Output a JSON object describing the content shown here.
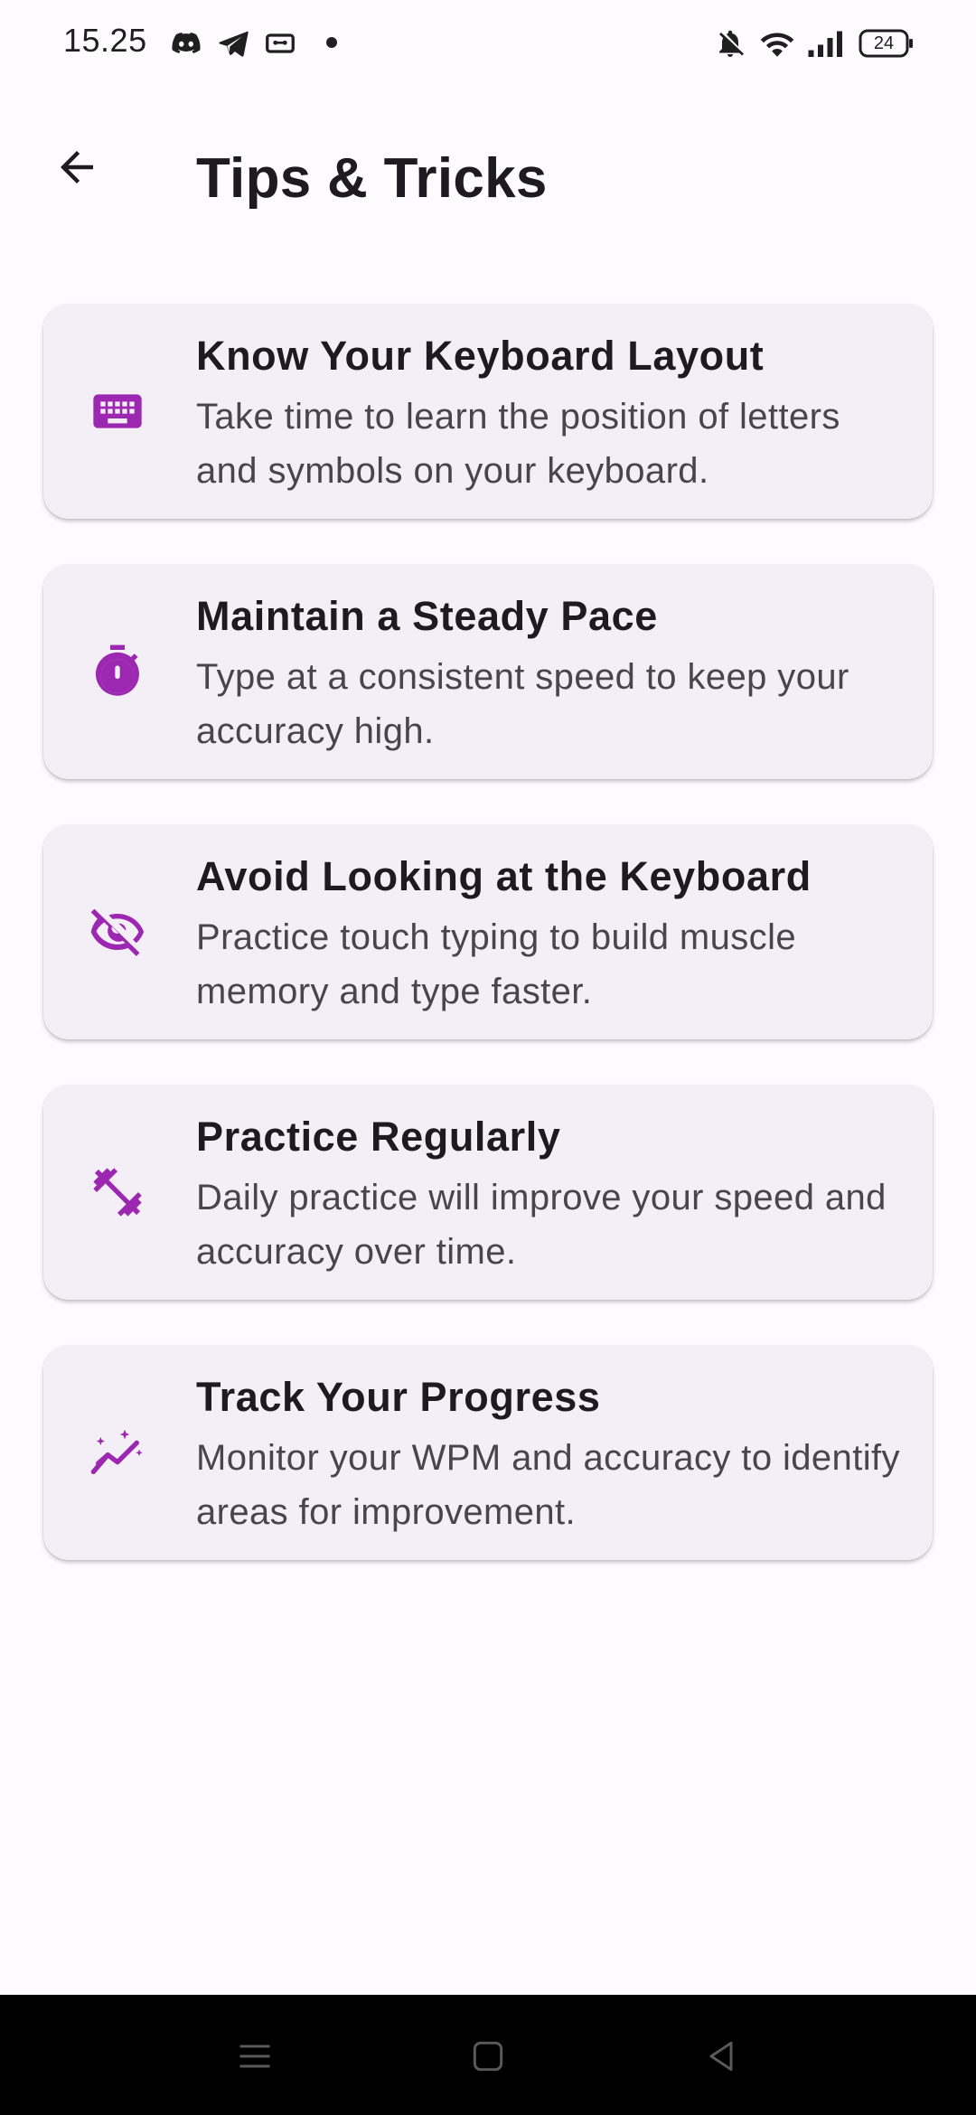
{
  "status_bar": {
    "time": "15.25",
    "battery": "24",
    "icons": [
      "discord-icon",
      "telegram-icon",
      "cassette-icon",
      "dot-icon",
      "bell-off-icon",
      "wifi-icon",
      "signal-icon",
      "battery-icon"
    ]
  },
  "app_bar": {
    "title": "Tips & Tricks",
    "back_icon": "arrow-left-icon"
  },
  "tips": [
    {
      "icon": "keyboard-icon",
      "title": "Know Your Keyboard Layout",
      "description": "Take time to learn the position of letters and symbols on your keyboard."
    },
    {
      "icon": "timer-icon",
      "title": "Maintain a Steady Pace",
      "description": "Type at a consistent speed to keep your accuracy high."
    },
    {
      "icon": "visibility-off-icon",
      "title": "Avoid Looking at the Keyboard",
      "description": "Practice touch typing to build muscle memory and type faster."
    },
    {
      "icon": "fitness-icon",
      "title": "Practice Regularly",
      "description": "Daily practice will improve your speed and accuracy over time."
    },
    {
      "icon": "insights-icon",
      "title": "Track Your Progress",
      "description": "Monitor your WPM and accuracy to identify areas for improvement."
    }
  ],
  "nav_bar": {
    "buttons": [
      "menu-icon",
      "home-icon",
      "back-triangle-icon"
    ]
  },
  "colors": {
    "accent": "#9c27b0",
    "card_background": "#f4eff6",
    "page_background": "#fefbff",
    "title_text": "#1d1b20",
    "body_text": "#49454f"
  }
}
